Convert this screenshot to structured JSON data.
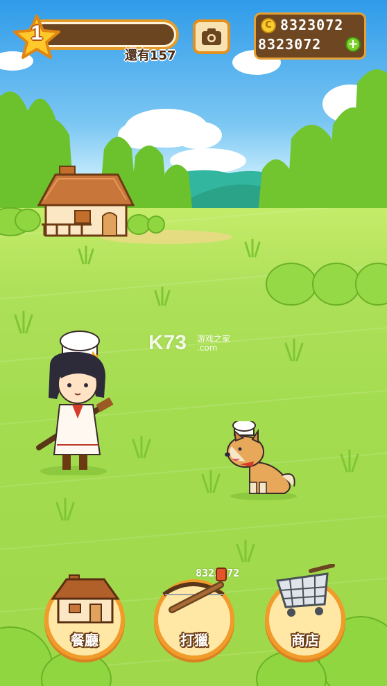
{
  "hud": {
    "level": "1",
    "remaining_label": "還有157",
    "level_progress": 0.0,
    "camera_icon": "camera-icon",
    "coins": "8323072",
    "gems": "8323072",
    "coin_symbol": "C",
    "add_symbol": "+"
  },
  "watermark": {
    "logo": "K73",
    "site_name": "游戏之家",
    "site_url": ".com"
  },
  "bottom_menu": {
    "restaurant_label": "餐廳",
    "hunt_label": "打獵",
    "shop_label": "商店",
    "hunt_count": "8323072"
  },
  "colors": {
    "accent": "#f09b2a",
    "panel": "#6e4621",
    "grass": "#a3dc4f"
  }
}
